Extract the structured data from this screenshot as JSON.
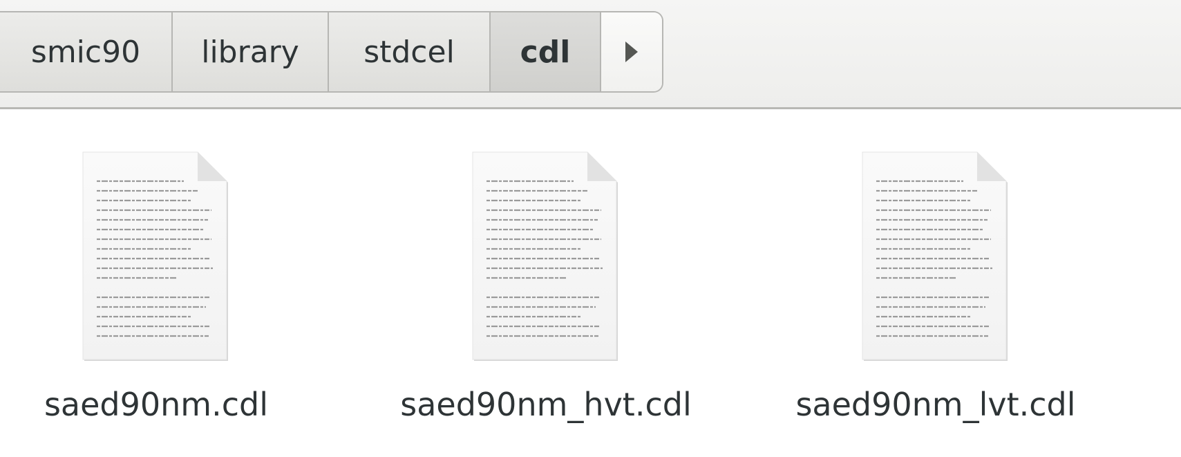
{
  "pathbar": {
    "crumbs": [
      {
        "label": "smic90"
      },
      {
        "label": "library"
      },
      {
        "label": "stdcel"
      },
      {
        "label": "cdl"
      }
    ],
    "more_icon": "triangle-right-icon"
  },
  "files": [
    {
      "name": "saed90nm.cdl",
      "icon": "text-document-icon"
    },
    {
      "name": "saed90nm_hvt.cdl",
      "icon": "text-document-icon"
    },
    {
      "name": "saed90nm_lvt.cdl",
      "icon": "text-document-icon"
    }
  ]
}
